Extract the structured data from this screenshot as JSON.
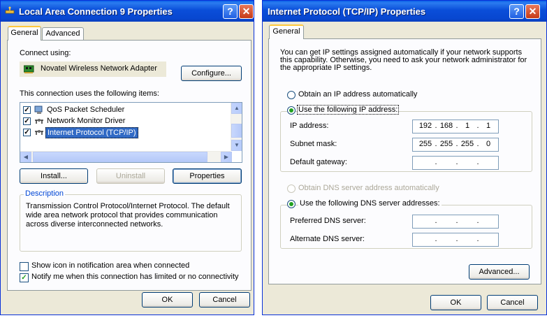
{
  "left_dialog": {
    "title": "Local Area Connection 9 Properties",
    "title_buttons": {
      "help": "?",
      "close": "✕"
    },
    "tabs": [
      {
        "label": "General",
        "active": true
      },
      {
        "label": "Advanced",
        "active": false
      }
    ],
    "connect_using_label": "Connect using:",
    "adapter_name": "Novatel Wireless Network Adapter",
    "adapter_icon": "network-card-icon",
    "configure_label": "Configure...",
    "items_label": "This connection uses the following items:",
    "items": [
      {
        "label": "QoS Packet Scheduler",
        "checked": true,
        "icon": "qos-icon",
        "selected": false
      },
      {
        "label": "Network Monitor Driver",
        "checked": true,
        "icon": "protocol-icon",
        "selected": false
      },
      {
        "label": "Internet Protocol (TCP/IP)",
        "checked": true,
        "icon": "protocol-icon",
        "selected": true
      }
    ],
    "install_label": "Install...",
    "uninstall_label": "Uninstall",
    "properties_label": "Properties",
    "description_label": "Description",
    "description_text": [
      "Transmission Control Protocol/Internet Protocol. The default",
      "wide area network protocol that provides communication",
      "across diverse interconnected networks."
    ],
    "show_icon_label": "Show icon in notification area when connected",
    "show_icon_checked": false,
    "notify_label": "Notify me when this connection has limited or no connectivity",
    "notify_checked": true,
    "ok_label": "OK",
    "cancel_label": "Cancel"
  },
  "right_dialog": {
    "title": "Internet Protocol (TCP/IP) Properties",
    "title_buttons": {
      "help": "?",
      "close": "✕"
    },
    "tab_label": "General",
    "intro_text": [
      "You can get IP settings assigned automatically if your network supports",
      "this capability. Otherwise, you need to ask your network administrator for",
      "the appropriate IP settings."
    ],
    "obtain_ip_label": "Obtain an IP address automatically",
    "obtain_ip_selected": false,
    "use_ip_label": "Use the following IP address:",
    "use_ip_selected": true,
    "ip_address_label": "IP address:",
    "ip_address": [
      "192",
      "168",
      "1",
      "1"
    ],
    "subnet_label": "Subnet mask:",
    "subnet_mask": [
      "255",
      "255",
      "255",
      "0"
    ],
    "gateway_label": "Default gateway:",
    "gateway": [
      "",
      "",
      "",
      ""
    ],
    "obtain_dns_label": "Obtain DNS server address automatically",
    "obtain_dns_selected": false,
    "use_dns_label": "Use the following DNS server addresses:",
    "use_dns_selected": true,
    "preferred_dns_label": "Preferred DNS server:",
    "preferred_dns": [
      "",
      "",
      "",
      ""
    ],
    "alternate_dns_label": "Alternate DNS server:",
    "alternate_dns": [
      "",
      "",
      "",
      ""
    ],
    "advanced_label": "Advanced...",
    "ok_label": "OK",
    "cancel_label": "Cancel"
  },
  "colors": {
    "title_bar": "#0a4ed9",
    "dialog_bg": "#ece9d8",
    "selection": "#316ac5",
    "group_label": "#0046d5",
    "check_green": "#21a121"
  }
}
